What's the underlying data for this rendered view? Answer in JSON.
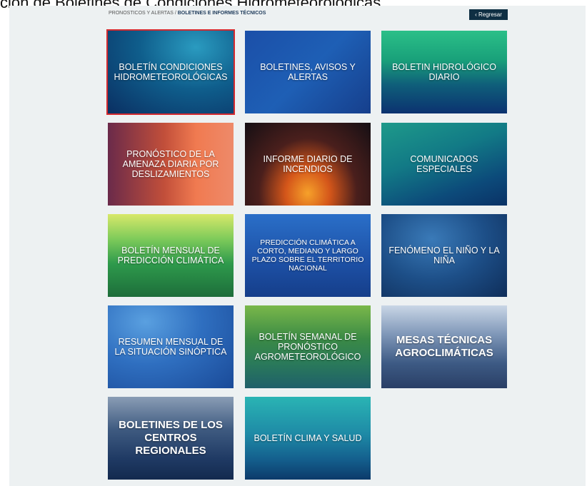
{
  "page_title": "ción de Boletines de Condiciones Hidrometeorológicas",
  "breadcrumb": {
    "section": "PRONOSTICOS Y ALERTAS",
    "separator": " / ",
    "current": "BOLETINES E INFORMES TÉCNICOS"
  },
  "back_button": {
    "label": "Regresar",
    "icon": "chevron-left-icon"
  },
  "tiles": [
    {
      "label": "BOLETÍN CONDICIONES HIDROMETEOROLÓGICAS",
      "selected": true
    },
    {
      "label": "BOLETINES, AVISOS Y ALERTAS"
    },
    {
      "label": "BOLETIN HIDROLÓGICO DIARIO"
    },
    {
      "label": "PRONÓSTICO DE LA AMENAZA DIARIA POR DESLIZAMIENTOS"
    },
    {
      "label": "INFORME DIARIO DE INCENDIOS"
    },
    {
      "label": "COMUNICADOS ESPECIALES"
    },
    {
      "label": "BOLETÍN MENSUAL DE PREDICCIÓN CLIMÁTICA"
    },
    {
      "label": "PREDICCIÓN CLIMÁTICA A CORTO, MEDIANO Y LARGO PLAZO SOBRE EL TERRITORIO NACIONAL"
    },
    {
      "label": "FENÓMENO EL NIÑO Y LA NIÑA"
    },
    {
      "label": "RESUMEN MENSUAL DE LA SITUACIÓN SINÓPTICA"
    },
    {
      "label": "BOLETÍN SEMANAL DE PRONÓSTICO AGROMETEOROLÓGICO"
    },
    {
      "label": "MESAS TÉCNICAS AGROCLIMÁTICAS"
    },
    {
      "label": "BOLETINES DE LOS CENTROS REGIONALES"
    },
    {
      "label": "BOLETÍN CLIMA Y SALUD"
    }
  ],
  "colors": {
    "selected_border": "#d42a2f",
    "back_button_bg": "#0f2f43",
    "panel_bg": "#edf1f2"
  }
}
